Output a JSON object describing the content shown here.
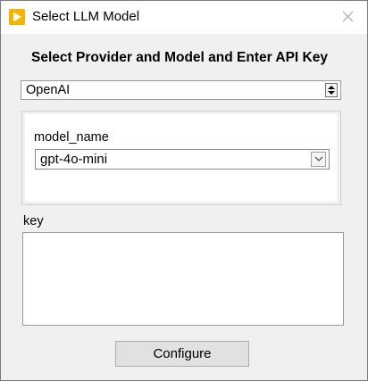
{
  "window": {
    "title": "Select LLM Model",
    "icon": "app-logo-icon",
    "accent_color": "#f5b400"
  },
  "form": {
    "heading": "Select Provider and Model and Enter API Key",
    "provider": {
      "value": "OpenAI",
      "control": "spinner"
    },
    "model": {
      "label": "model_name",
      "value": "gpt-4o-mini"
    },
    "key": {
      "label": "key",
      "value": ""
    },
    "configure_label": "Configure"
  }
}
